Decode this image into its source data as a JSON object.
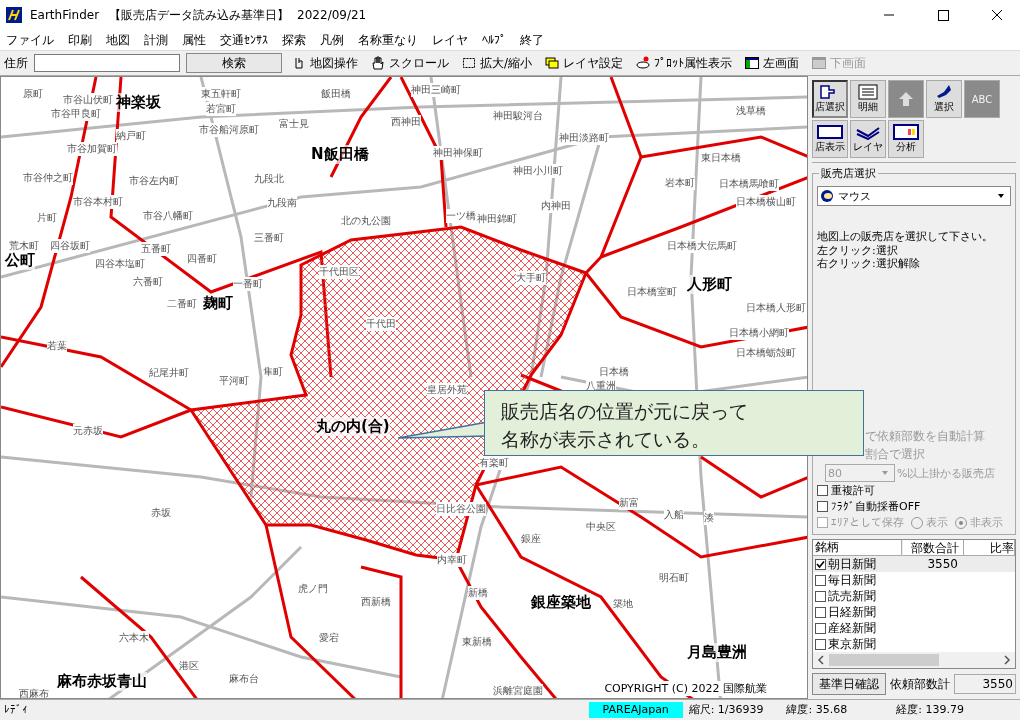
{
  "window": {
    "app_name": "EarthFinder",
    "title": "【販売店データ読み込み基準日】",
    "date": "2022/09/21"
  },
  "menu": [
    "ファイル",
    "印刷",
    "地図",
    "計測",
    "属性",
    "交通ｾﾝｻｽ",
    "探索",
    "凡例",
    "名称重なり",
    "レイヤ",
    "ﾍﾙﾌﾟ",
    "終了"
  ],
  "toolbar": {
    "address_label": "住所",
    "search_button": "検索",
    "tools": [
      {
        "label": "地図操作",
        "disabled": false
      },
      {
        "label": "スクロール",
        "disabled": false
      },
      {
        "label": "拡大/縮小",
        "disabled": false
      },
      {
        "label": "レイヤ設定",
        "disabled": false
      },
      {
        "label": "ﾌﾟﾛｯﾄ属性表示",
        "disabled": false
      },
      {
        "label": "左画面",
        "disabled": false
      },
      {
        "label": "下画面",
        "disabled": true
      }
    ]
  },
  "map": {
    "major_labels": [
      "神楽坂",
      "N飯田橋",
      "公町",
      "麹町",
      "人形町",
      "丸の内(合)",
      "銀座築地",
      "月島豊洲",
      "麻布赤坂青山"
    ],
    "minor_labels": [
      "原町",
      "市谷山伏町",
      "市谷甲良町",
      "東五軒町",
      "若宮町",
      "納戸町",
      "市谷船河原町",
      "富士見",
      "飯田橋",
      "神田三崎町",
      "西神田",
      "神田神保町",
      "神田駿河台",
      "神田淡路町",
      "神田小川町",
      "浅草橋",
      "東日本橋",
      "岩本町",
      "日本橋馬喰町",
      "日本橋横山町",
      "日本橋大伝馬町",
      "日本橋室町",
      "日本橋人形町",
      "日本橋小網町",
      "日本橋蛎殻町",
      "日本橋",
      "八重洲",
      "内神田",
      "北の丸公園",
      "一ツ橋",
      "神田錦町",
      "大手町",
      "千代田区",
      "千代田",
      "皇居外苑",
      "日比谷公園",
      "有楽町",
      "内幸町",
      "西新橋",
      "新橋",
      "虎ノ門",
      "愛宕",
      "東新橋",
      "浜離宮庭園",
      "港区",
      "六本木",
      "西麻布",
      "赤坂",
      "元赤坂",
      "紀尾井町",
      "平河町",
      "隼町",
      "二番町",
      "六番町",
      "四番町",
      "一番町",
      "九段北",
      "九段南",
      "三番町",
      "五番町",
      "四谷本塩町",
      "荒木町",
      "四谷坂町",
      "片町",
      "市谷八幡町",
      "市谷本村町",
      "市谷左内町",
      "市谷加賀町",
      "市谷仲之町",
      "若葉",
      "新富",
      "中央区",
      "入船",
      "湊",
      "銀座",
      "明石町",
      "築地",
      "麻布台"
    ],
    "copyright": "COPYRIGHT (C) 2022 国際航業",
    "callout": [
      "販売店名の位置が元に戻って",
      "名称が表示されている。"
    ]
  },
  "tools_panel": [
    {
      "label": "店選択",
      "disabled": false,
      "selected": true
    },
    {
      "label": "明細",
      "disabled": false,
      "selected": false
    },
    {
      "disabled": true,
      "selected": false
    },
    {
      "label": "選択",
      "disabled": false,
      "selected": false
    },
    {
      "label": "ABC",
      "disabled": true,
      "selected": false
    },
    {
      "label": "店表示",
      "disabled": false,
      "selected": false
    },
    {
      "label": "レイヤ",
      "disabled": false,
      "selected": false
    },
    {
      "label": "分析",
      "disabled": false,
      "selected": false
    }
  ],
  "selection": {
    "group_title": "販売店選択",
    "mode": "マウス",
    "instruction": "地図上の販売店を選択して下さい。",
    "hints": [
      "左クリック:選択",
      "右クリック:選択解除"
    ],
    "auto_calc": "で依頼部数を自動計算",
    "ratio_select": "割合で選択",
    "percent_value": "80",
    "percent_label": "%以上掛かる販売店",
    "options": [
      {
        "label": "重複許可",
        "checked": false,
        "disabled": false
      },
      {
        "label": "ﾌﾗｸﾞ自動採番OFF",
        "checked": false,
        "disabled": false
      },
      {
        "label": "ｴﾘｱとして保存",
        "checked": false,
        "disabled": true
      }
    ],
    "radios": [
      {
        "label": "表示",
        "selected": false
      },
      {
        "label": "非表示",
        "selected": true
      }
    ]
  },
  "table": {
    "columns": [
      "銘柄",
      "部数合計",
      "比率"
    ],
    "rows": [
      {
        "name": "朝日新聞",
        "checked": true,
        "total": "3550",
        "selected": true
      },
      {
        "name": "毎日新聞",
        "checked": false,
        "selected": false
      },
      {
        "name": "読売新聞",
        "checked": false,
        "selected": false
      },
      {
        "name": "日経新聞",
        "checked": false,
        "selected": false
      },
      {
        "name": "産経新聞",
        "checked": false,
        "selected": false
      },
      {
        "name": "東京新聞",
        "checked": false,
        "selected": false
      }
    ]
  },
  "footer": {
    "confirm_button": "基準日確認",
    "request_label": "依頼部数計",
    "request_value": "3550"
  },
  "status_bar": {
    "state": "ﾚﾃﾞｨ",
    "layer": "PAREAJapan",
    "scale": "縮尺: 1/36939",
    "lat": "緯度: 35.68",
    "lon": "経度: 139.79"
  }
}
